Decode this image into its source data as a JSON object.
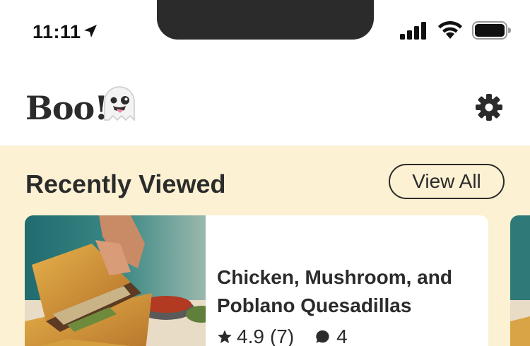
{
  "status_bar": {
    "time": "11:11",
    "icons": [
      "location-arrow-icon",
      "cellular-signal-icon",
      "wifi-icon",
      "battery-icon"
    ]
  },
  "header": {
    "brand": "Boo!",
    "brand_icon": "ghost-icon",
    "settings_icon": "gear-icon"
  },
  "recently_viewed": {
    "title": "Recently Viewed",
    "view_all_label": "View All",
    "cards": [
      {
        "title": "Chicken, Mushroom, and Poblano Quesadillas",
        "rating": "4.9",
        "rating_count": "(7)",
        "comments": "4",
        "image": "quesadilla-photo"
      }
    ]
  },
  "colors": {
    "section_bg": "#fdf1d3",
    "text": "#2b2b2b",
    "card_bg": "#ffffff"
  }
}
